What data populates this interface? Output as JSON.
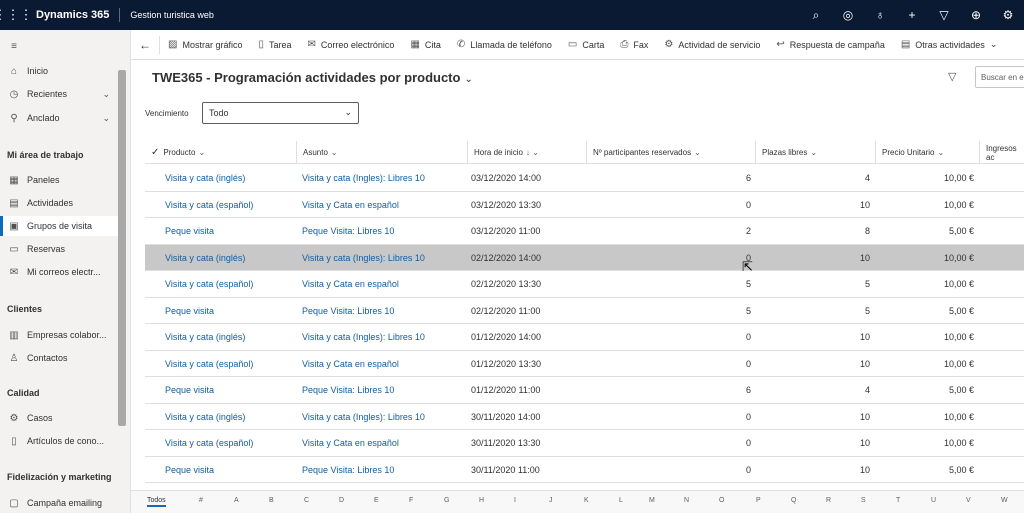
{
  "topbar": {
    "brand": "Dynamics 365",
    "app": "Gestion turistica web",
    "icons": [
      "search-icon",
      "target-icon",
      "lightbulb-icon",
      "plus-icon",
      "filter-icon",
      "help-icon",
      "settings-icon"
    ]
  },
  "sidebar": {
    "items_top": [
      {
        "label": "Inicio",
        "icon": "home-icon"
      },
      {
        "label": "Recientes",
        "icon": "clock-icon"
      },
      {
        "label": "Anclado",
        "icon": "pin-icon"
      }
    ],
    "section_work": "Mi área de trabajo",
    "items_work": [
      {
        "label": "Paneles"
      },
      {
        "label": "Actividades"
      },
      {
        "label": "Grupos de visita"
      },
      {
        "label": "Reservas"
      },
      {
        "label": "Mi correos electr..."
      }
    ],
    "section_clients": "Clientes",
    "items_clients": [
      {
        "label": "Empresas colabor..."
      },
      {
        "label": "Contactos"
      }
    ],
    "section_quality": "Calidad",
    "items_quality": [
      {
        "label": "Casos"
      },
      {
        "label": "Artículos de cono..."
      }
    ],
    "section_marketing": "Fidelización y marketing",
    "items_marketing": [
      {
        "label": "Campaña emailing"
      }
    ]
  },
  "commandbar": {
    "items": [
      "Mostrar gráfico",
      "Tarea",
      "Correo electrónico",
      "Cita",
      "Llamada de teléfono",
      "Carta",
      "Fax",
      "Actividad de servicio",
      "Respuesta de campaña",
      "Otras actividades"
    ]
  },
  "view": {
    "title": "TWE365 - Programación actividades por producto",
    "search_placeholder": "Buscar en e",
    "filter_label": "Vencimiento",
    "filter_value": "Todo"
  },
  "grid": {
    "columns": [
      "Producto",
      "Asunto",
      "Hora de inicio",
      "Nº participantes reservados",
      "Plazas libres",
      "Precio Unitario",
      "Ingresos ac"
    ],
    "rows": [
      {
        "producto": "Visita y cata (inglés)",
        "asunto": "Visita y cata (Ingles): Libres 10",
        "hora": "03/12/2020 14:00",
        "participantes": "6",
        "plazas": "4",
        "precio": "10,00 €"
      },
      {
        "producto": "Visita y cata (español)",
        "asunto": "Visita y Cata en español",
        "hora": "03/12/2020 13:30",
        "participantes": "0",
        "plazas": "10",
        "precio": "10,00 €"
      },
      {
        "producto": "Peque visita",
        "asunto": "Peque Visita: Libres 10",
        "hora": "03/12/2020 11:00",
        "participantes": "2",
        "plazas": "8",
        "precio": "5,00 €"
      },
      {
        "producto": "Visita y cata (inglés)",
        "asunto": "Visita y cata (Ingles): Libres 10",
        "hora": "02/12/2020 14:00",
        "participantes": "0",
        "plazas": "10",
        "precio": "10,00 €"
      },
      {
        "producto": "Visita y cata (español)",
        "asunto": "Visita y Cata en español",
        "hora": "02/12/2020 13:30",
        "participantes": "5",
        "plazas": "5",
        "precio": "10,00 €"
      },
      {
        "producto": "Peque visita",
        "asunto": "Peque Visita: Libres 10",
        "hora": "02/12/2020 11:00",
        "participantes": "5",
        "plazas": "5",
        "precio": "5,00 €"
      },
      {
        "producto": "Visita y cata (inglés)",
        "asunto": "Visita y cata (Ingles): Libres 10",
        "hora": "01/12/2020 14:00",
        "participantes": "0",
        "plazas": "10",
        "precio": "10,00 €"
      },
      {
        "producto": "Visita y cata (español)",
        "asunto": "Visita y Cata en español",
        "hora": "01/12/2020 13:30",
        "participantes": "0",
        "plazas": "10",
        "precio": "10,00 €"
      },
      {
        "producto": "Peque visita",
        "asunto": "Peque Visita: Libres 10",
        "hora": "01/12/2020 11:00",
        "participantes": "6",
        "plazas": "4",
        "precio": "5,00 €"
      },
      {
        "producto": "Visita y cata (inglés)",
        "asunto": "Visita y cata (Ingles): Libres 10",
        "hora": "30/11/2020 14:00",
        "participantes": "0",
        "plazas": "10",
        "precio": "10,00 €"
      },
      {
        "producto": "Visita y cata (español)",
        "asunto": "Visita y Cata en español",
        "hora": "30/11/2020 13:30",
        "participantes": "0",
        "plazas": "10",
        "precio": "10,00 €"
      },
      {
        "producto": "Peque visita",
        "asunto": "Peque Visita: Libres 10",
        "hora": "30/11/2020 11:00",
        "participantes": "0",
        "plazas": "10",
        "precio": "5,00 €"
      }
    ]
  },
  "alphabet": [
    "Todos",
    "#",
    "A",
    "B",
    "C",
    "D",
    "E",
    "F",
    "G",
    "H",
    "I",
    "J",
    "K",
    "L",
    "M",
    "N",
    "O",
    "P",
    "Q",
    "R",
    "S",
    "T",
    "U",
    "V",
    "W"
  ]
}
